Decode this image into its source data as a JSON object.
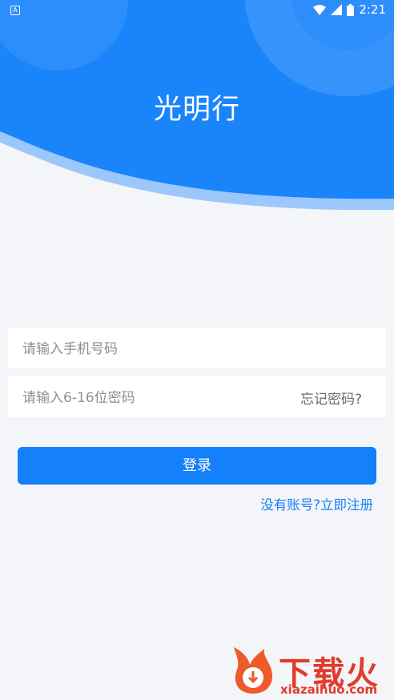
{
  "status_bar": {
    "app_indicator": "A",
    "time": "2:21"
  },
  "header": {
    "title": "光明行"
  },
  "form": {
    "phone_placeholder": "请输入手机号码",
    "password_placeholder": "请输入6-16位密码",
    "forgot_password": "忘记密码?"
  },
  "actions": {
    "login_label": "登录",
    "register_link": "没有账号?立即注册"
  },
  "watermark": {
    "brand": "下载火",
    "url": "xiazaihuo.com"
  },
  "colors": {
    "primary": "#1580fb",
    "header_blue": "#1a84fb",
    "background": "#f3f5f8"
  }
}
